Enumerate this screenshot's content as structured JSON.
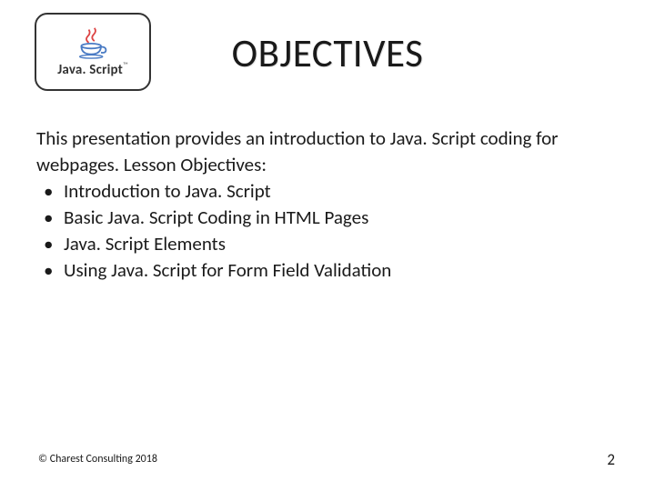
{
  "logo": {
    "text": "Java. Script",
    "tm": "™"
  },
  "title": "OBJECTIVES",
  "intro": "This presentation provides an introduction to Java. Script coding for webpages. Lesson Objectives:",
  "bullets": [
    "Introduction to Java. Script",
    "Basic Java. Script Coding in HTML Pages",
    "Java. Script Elements",
    "Using Java. Script for Form Field Validation"
  ],
  "footer": {
    "copyright": "© Charest Consulting 2018",
    "page": "2"
  }
}
